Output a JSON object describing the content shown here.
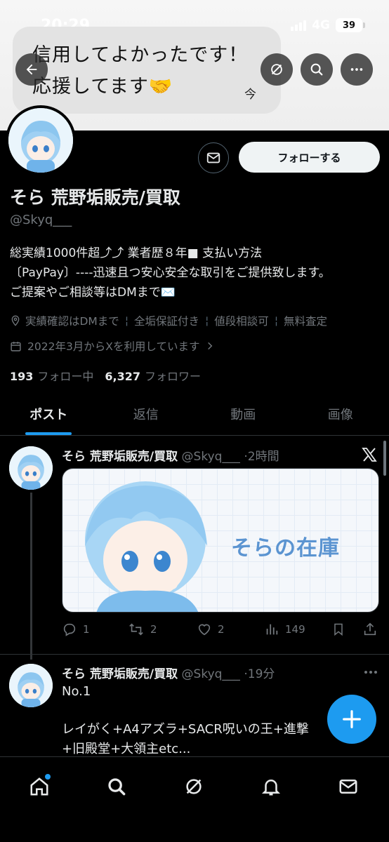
{
  "status_bar": {
    "time": "20:29",
    "network": "4G",
    "battery": "39"
  },
  "banner": {
    "bubble_line1": "信用してよかったです！",
    "bubble_line2": "応援してます🤝",
    "bubble_time": "今"
  },
  "profile": {
    "follow_label": "フォローする",
    "name": "そら 荒野垢販売/買取",
    "handle": "@Skyq___",
    "bio_line1": "総実績1000件超⤴︎⤴︎ 業者歴８年■ 支払い方法",
    "bio_line2": "〔PayPay〕----迅速且つ安心安全な取引をご提供致します。",
    "bio_line3": "ご提案やご相談等はDMまで✉️",
    "meta": {
      "location": "実績確認はDMまで",
      "tag2": "全垢保証付き",
      "tag3": "値段相談可",
      "tag4": "無料査定"
    },
    "joined": "2022年3月からXを利用しています",
    "following_count": "193",
    "following_label": "フォロー中",
    "followers_count": "6,327",
    "followers_label": "フォロワー"
  },
  "tabs": [
    "ポスト",
    "返信",
    "動画",
    "画像"
  ],
  "posts": [
    {
      "name": "そら 荒野垢販売/買取",
      "handle": "@Skyq___",
      "time": "·2時間",
      "media_title": "そらの在庫",
      "replies": "1",
      "reposts": "2",
      "likes": "2",
      "views": "149"
    },
    {
      "name": "そら 荒野垢販売/買取",
      "handle": "@Skyq___",
      "time": "·19分",
      "line1": "No.1",
      "line2": "レイがく+A4アズラ+SACR呪いの王+進撃",
      "line3": "+旧殿堂+大領主etc..."
    }
  ],
  "colors": {
    "accent": "#1d9bf0",
    "background": "#000000",
    "muted": "#71767b"
  }
}
